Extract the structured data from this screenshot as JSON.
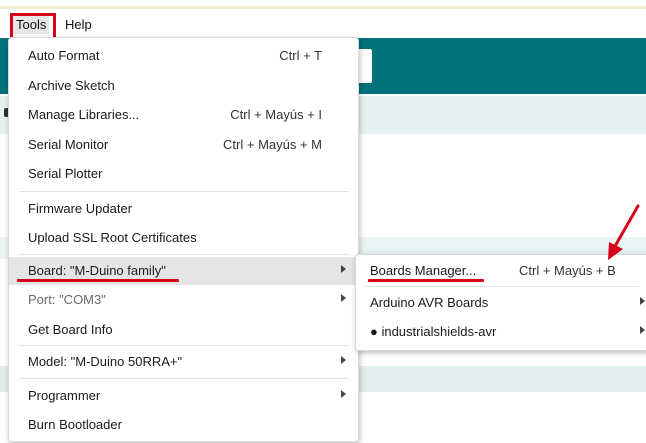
{
  "menubar": {
    "tools": "Tools",
    "help": "Help"
  },
  "tools_menu": {
    "items": [
      {
        "label": "Auto Format",
        "shortcut": "Ctrl + T"
      },
      {
        "label": "Archive Sketch",
        "shortcut": ""
      },
      {
        "label": "Manage Libraries...",
        "shortcut": "Ctrl + Mayús + I"
      },
      {
        "label": "Serial Monitor",
        "shortcut": "Ctrl + Mayús + M"
      },
      {
        "label": "Serial Plotter",
        "shortcut": ""
      },
      {
        "label": "Firmware Updater",
        "shortcut": ""
      },
      {
        "label": "Upload SSL Root Certificates",
        "shortcut": ""
      },
      {
        "label": "Board: \"M-Duino family\"",
        "shortcut": ""
      },
      {
        "label": "Port: \"COM3\"",
        "shortcut": ""
      },
      {
        "label": "Get Board Info",
        "shortcut": ""
      },
      {
        "label": "Model: \"M-Duino 50RRA+\"",
        "shortcut": ""
      },
      {
        "label": "Programmer",
        "shortcut": ""
      },
      {
        "label": "Burn Bootloader",
        "shortcut": ""
      }
    ]
  },
  "board_submenu": {
    "items": [
      {
        "label": "Boards Manager...",
        "shortcut": "Ctrl + Mayús + B"
      },
      {
        "label": "Arduino AVR Boards",
        "shortcut": ""
      },
      {
        "label": "● industrialshields-avr",
        "shortcut": ""
      }
    ]
  },
  "colors": {
    "annotation_red": "#d6001c",
    "header_teal": "#00727a",
    "highlight": "#e5e5e5"
  },
  "icons": [
    "submenu-arrow-icon",
    "annotation-arrow-icon"
  ]
}
